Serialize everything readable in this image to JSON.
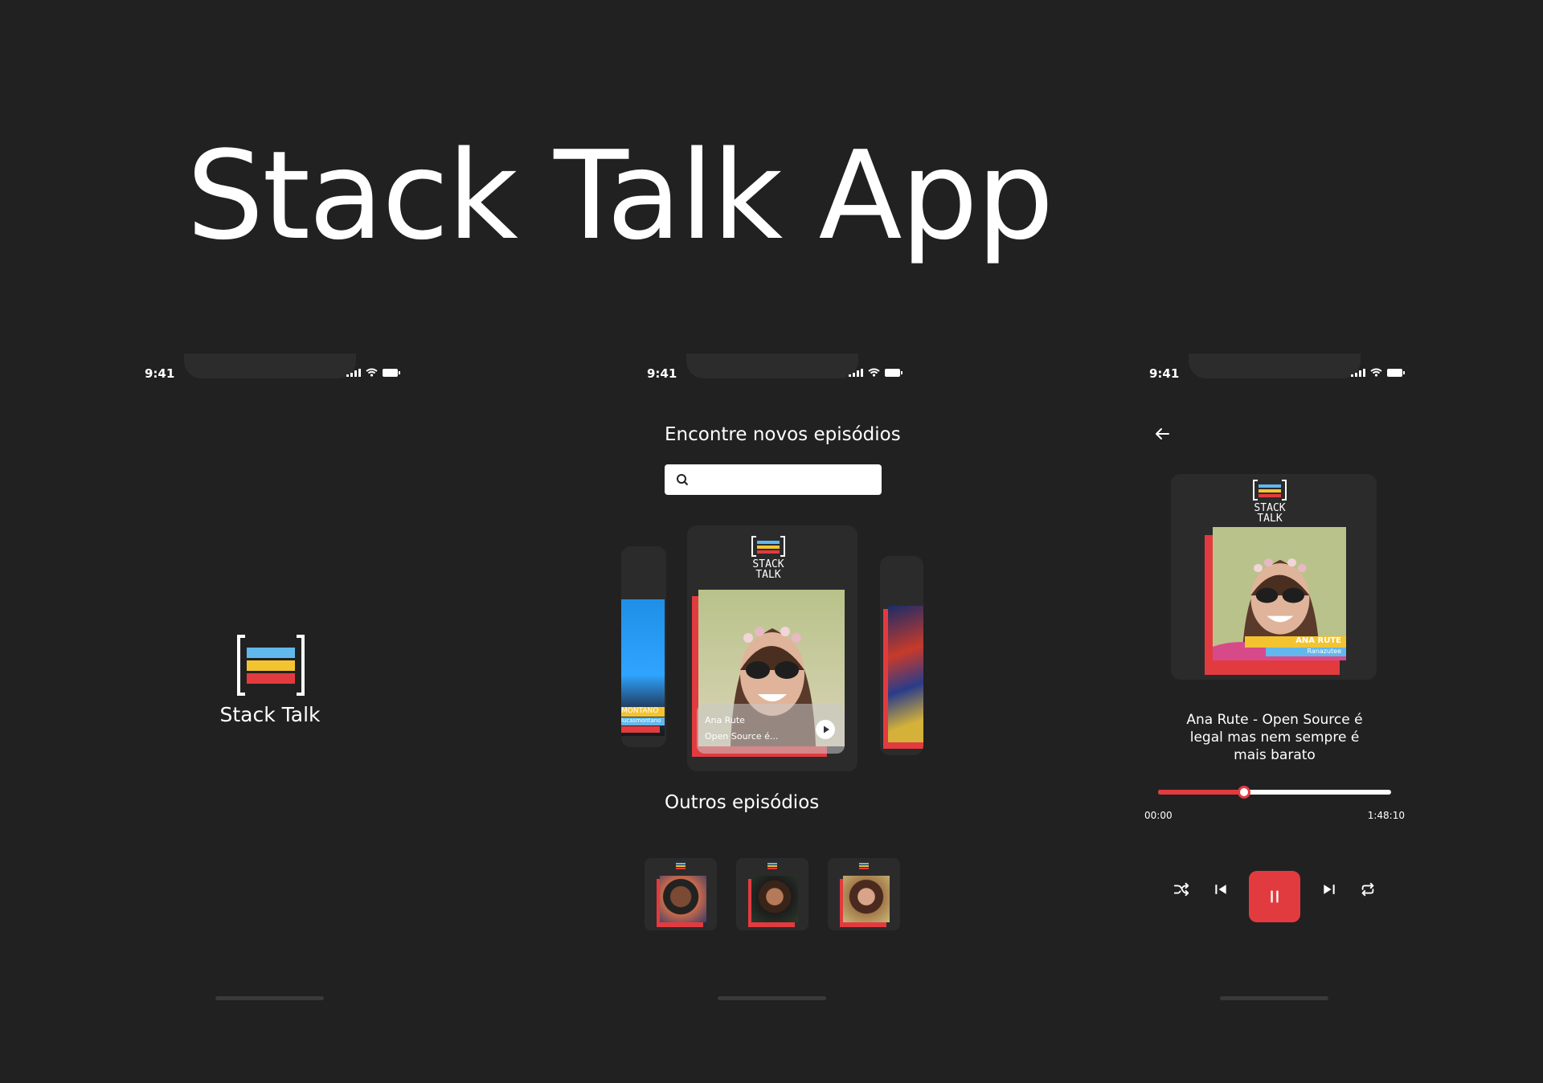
{
  "hero": {
    "title": "Stack Talk App"
  },
  "status": {
    "time": "9:41"
  },
  "splash": {
    "app_name": "Stack Talk"
  },
  "discover": {
    "heading": "Encontre novos episódios",
    "search_value": "",
    "featured": {
      "host": "Ana Rute",
      "title": "Open Source é..."
    },
    "side_left_label": "MONTANO",
    "side_left_sublabel": "lucasmontano",
    "other_heading": "Outros episódios"
  },
  "player": {
    "episode_title": "Ana Rute - Open Source é legal mas nem sempre é mais barato",
    "cover_name": "ANA RUTE",
    "cover_handle": "Ranazutee",
    "time_current": "00:00",
    "time_total": "1:48:10",
    "progress": 0.37
  },
  "logo": {
    "line1": "STACK",
    "line2": "TALK"
  },
  "colors": {
    "accent": "#e23b3f",
    "blue": "#62b8ec",
    "yellow": "#f4c430",
    "background": "#212121",
    "card": "#2b2b2b"
  },
  "icons": [
    "back-arrow-icon",
    "search-icon",
    "play-icon",
    "shuffle-icon",
    "skip-previous-icon",
    "pause-icon",
    "skip-next-icon",
    "repeat-icon",
    "signal-icon",
    "wifi-icon",
    "battery-icon"
  ]
}
